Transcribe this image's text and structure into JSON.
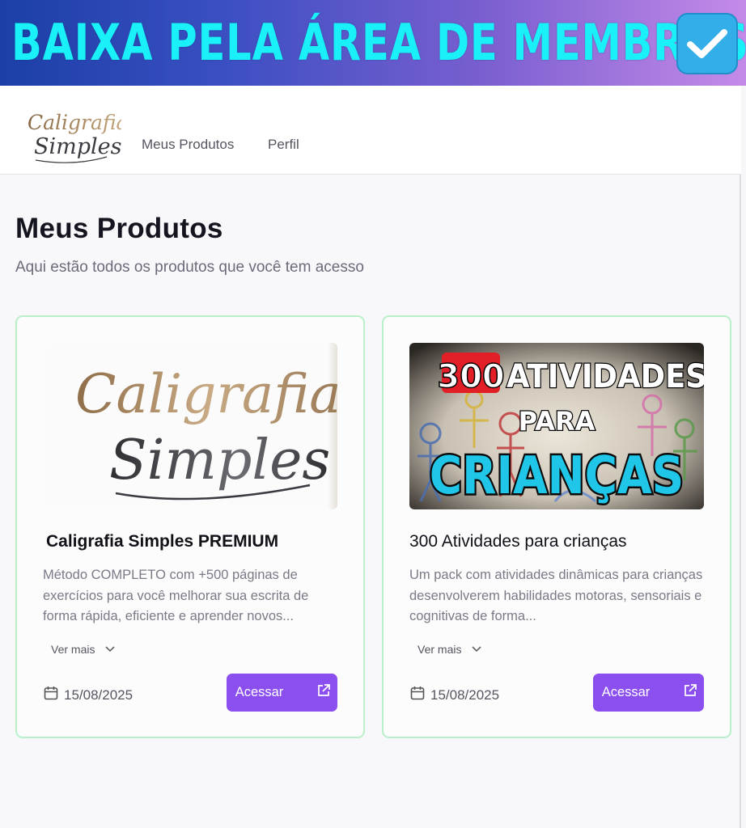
{
  "banner": {
    "text": "BAIXA PELA ÁREA DE MEMBROS",
    "icon": "check-box-icon",
    "colors": {
      "text": "#19f0f7",
      "check_bg": "#33aee8"
    }
  },
  "nav": {
    "logo_text_line1": "Caligrafia",
    "logo_text_line2": "Simples",
    "links": [
      "Meus Produtos",
      "Perfil"
    ]
  },
  "page": {
    "title": "Meus Produtos",
    "subtitle": "Aqui estão todos os produtos que você tem acesso"
  },
  "products": [
    {
      "image_text_line1": "Caligrafia",
      "image_text_line2": "Simples",
      "title": "Caligrafia Simples PREMIUM",
      "description": "Método COMPLETO com +500 páginas de exercícios para você melhorar sua escrita de forma rápida, eficiente e aprender novos...",
      "more_label": "Ver mais",
      "date": "15/08/2025",
      "button_label": "Acessar"
    },
    {
      "image_text_line1": "300 ATIVIDADES",
      "image_text_line1_number": "300",
      "image_text_line1_rest": "ATIVIDADES",
      "image_text_line2": "PARA",
      "image_text_line3": "CRIANÇAS",
      "title": "300 Atividades para crianças",
      "description": "Um pack com atividades dinâmicas para crianças desenvolverem habilidades motoras, sensoriais e cognitivas de forma...",
      "more_label": "Ver mais",
      "date": "15/08/2025",
      "button_label": "Acessar"
    }
  ],
  "colors": {
    "accent": "#8b4ff0",
    "card_border": "#b9efc9"
  }
}
